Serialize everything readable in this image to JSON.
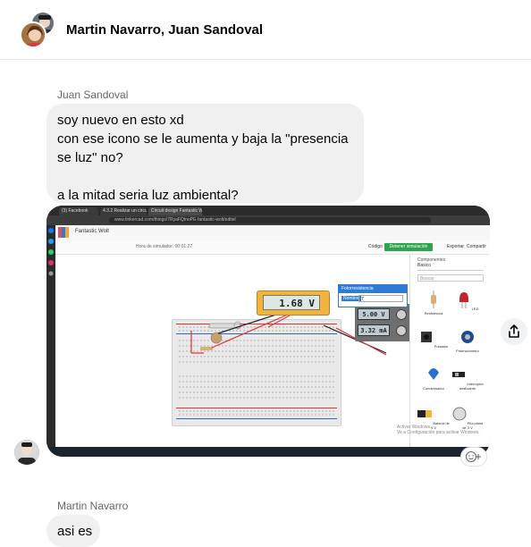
{
  "header": {
    "title": "Martin Navarro, Juan Sandoval"
  },
  "messages": [
    {
      "sender": "Juan Sandoval",
      "lines": [
        "soy nuevo en esto xd",
        "con ese icono se le aumenta y baja la \"presencia",
        "se luz\" no?",
        "",
        "a la mitad seria luz ambiental?"
      ]
    },
    {
      "sender": "Martin Navarro",
      "lines": [
        "asi es"
      ]
    }
  ],
  "attachment": {
    "tabs": [
      "(3) Facebook",
      "4.3.2 Realizar un circuit",
      "Circuit design Fantastic W"
    ],
    "url": "www.tinkercad.com/things/7RyaFQtnoPE-fantastic-wolt/editel",
    "app_name": "Fantastic Wolt",
    "sim_time": "Hora de simulador: 00:01:27",
    "toolbar": {
      "code": "Código",
      "start_sim": "Detener simulación",
      "export": "Exportar",
      "share": "Compartir"
    },
    "meter_reading": "1.68 V",
    "psu_voltage": "5.00 V",
    "psu_current": "3.32 mA",
    "popup": {
      "title": "Fotorresistencia",
      "label": "Nombre",
      "value": "7"
    },
    "panel": {
      "heading": "Componentes",
      "selection": "Básico",
      "search_placeholder": "Buscar",
      "components": [
        "Resistencia",
        "LED",
        "Pulsador",
        "Potenciómetro",
        "Condensador",
        "Interruptor deslizante",
        "Batería de 9 V",
        "Pila plana de 3 V"
      ]
    },
    "watermark": [
      "Activar Windows",
      "Ve a Configuración para activar Windows."
    ]
  },
  "colors": {
    "bubble": "#f0f0f0",
    "meter": "#f2b43a",
    "accent": "#2e7bd6"
  }
}
